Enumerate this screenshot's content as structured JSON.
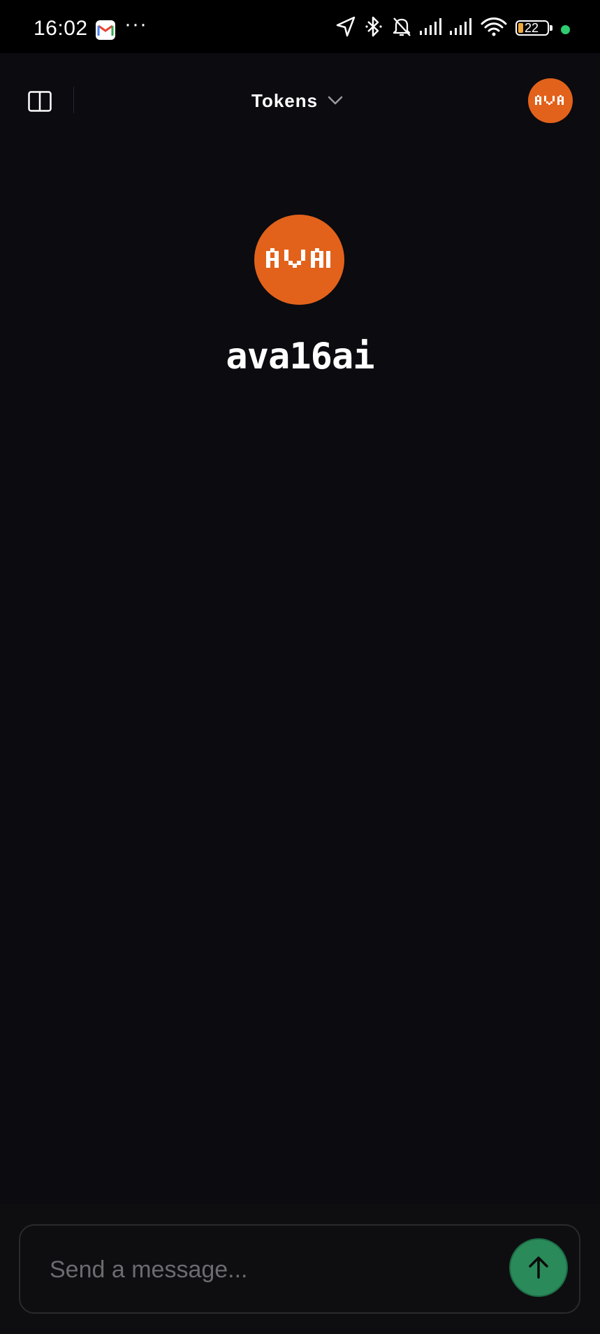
{
  "status_bar": {
    "time": "16:02",
    "more_indicator": "···",
    "battery_level": "22",
    "icons": [
      "gmail-icon",
      "location-icon",
      "bluetooth-icon",
      "bell-off-icon",
      "signal-icon",
      "signal-icon",
      "wifi-icon",
      "battery-icon",
      "privacy-dot-icon"
    ]
  },
  "header": {
    "model_label": "Tokens",
    "sidebar_icon": "sidebar-toggle-icon",
    "dropdown_icon": "chevron-down-icon"
  },
  "profile": {
    "name": "ava16ai"
  },
  "composer": {
    "placeholder": "Send a message...",
    "value": "",
    "send_icon": "arrow-up-icon"
  },
  "colors": {
    "background": "#0b0b10",
    "accent_orange": "#e2621b",
    "send_green": "#2a8a5a"
  }
}
